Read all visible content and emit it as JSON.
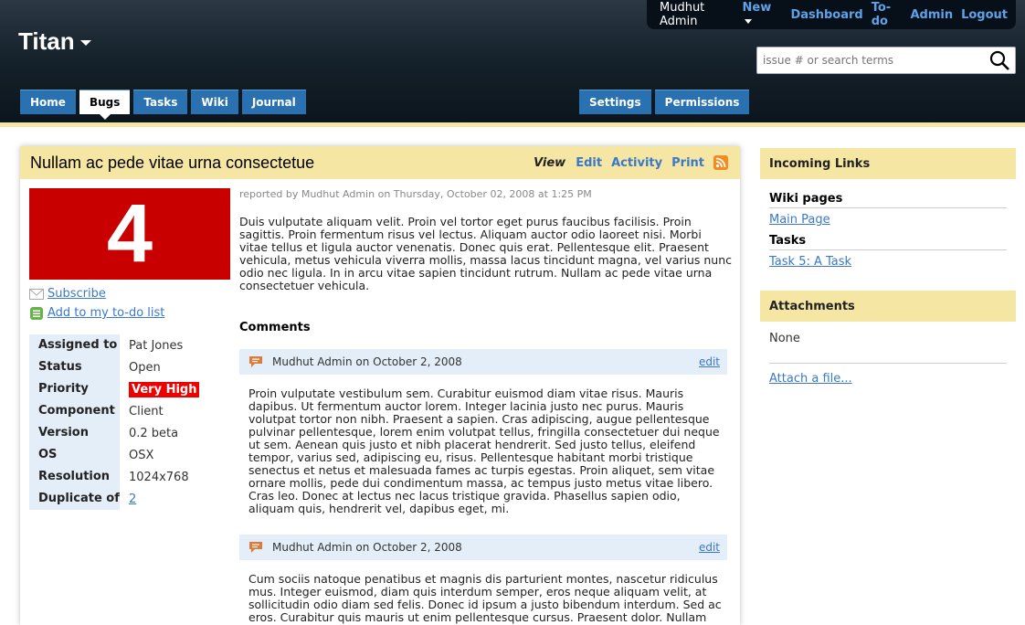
{
  "header": {
    "logo": "Titan",
    "user_name": "Mudhut Admin",
    "nav_links": [
      "New",
      "Dashboard",
      "To-do",
      "Admin",
      "Logout"
    ],
    "search_placeholder": "issue # or search terms",
    "tabs": [
      "Home",
      "Bugs",
      "Tasks",
      "Wiki",
      "Journal"
    ],
    "active_tab": "Bugs",
    "right_tabs": [
      "Settings",
      "Permissions"
    ]
  },
  "issue": {
    "title": "Nullam ac pede vitae urna consectetue",
    "view_label": "View",
    "view_links": [
      "Edit",
      "Activity",
      "Print"
    ],
    "number": "4",
    "subscribe": "Subscribe",
    "add_todo": "Add to my to-do list",
    "reported_by": "reported by Mudhut Admin on Thursday, October 02, 2008 at 1:25 PM",
    "description": "Duis vulputate aliquam velit. Proin vel tortor eget purus faucibus facilisis. Proin sagittis. Proin fermentum risus vel lectus. Aliquam auctor odio laoreet nisi. Morbi vitae tellus et ligula auctor venenatis. Donec quis erat. Pellentesque elit. Praesent vehicula, metus vehicula viverra mollis, massa lacus tincidunt magna, vel varius nunc odio nec ligula. In in arcu vitae sapien tincidunt rutrum. Nullam ac pede vitae urna consectetuer vehicula.",
    "properties": [
      {
        "key": "Assigned to",
        "value": "Pat Jones"
      },
      {
        "key": "Status",
        "value": "Open"
      },
      {
        "key": "Priority",
        "value": "Very High"
      },
      {
        "key": "Component",
        "value": "Client"
      },
      {
        "key": "Version",
        "value": "0.2 beta"
      },
      {
        "key": "OS",
        "value": "OSX"
      },
      {
        "key": "Resolution",
        "value": "1024x768"
      },
      {
        "key": "Duplicate of",
        "value": "2"
      }
    ]
  },
  "comments": {
    "heading": "Comments",
    "items": [
      {
        "author": "Mudhut Admin on October 2, 2008",
        "edit": "edit",
        "text": "Proin vulputate vestibulum sem. Curabitur euismod diam vitae risus. Mauris dapibus. Ut fermentum auctor lorem. Integer lacinia justo nec purus. Mauris volutpat tortor non nibh. Praesent a sapien. Cras adipiscing, augue pellentesque pulvinar pellentesque, lorem enim volutpat tellus, fringilla consectetuer dui neque ut sem. Aenean quis justo et nibh placerat hendrerit. Sed justo tellus, eleifend tempor, varius sed, adipiscing eu, risus. Pellentesque habitant morbi tristique senectus et netus et malesuada fames ac turpis egestas. Proin aliquet, sem vitae ornare mollis, pede dui condimentum massa, ac tempus justo metus vitae libero. Cras leo. Donec at lectus nec lacus tristique gravida. Phasellus sapien odio, aliquam quis, hendrerit vel, dapibus eget, mi."
      },
      {
        "author": "Mudhut Admin on October 2, 2008",
        "edit": "edit",
        "text": "Cum sociis natoque penatibus et magnis dis parturient montes, nascetur ridiculus mus. Integer euismod, diam quis interdum semper, eros neque aliquam velit, at sollicitudin odio diam sed felis. Donec id ipsum a justo bibendum interdum. Sed ac eros. Curabitur quis mauris ut enim pellentesque cursus. Praesent dolor. Nullam"
      }
    ]
  },
  "sidebar": {
    "incoming_heading": "Incoming Links",
    "wiki_heading": "Wiki pages",
    "wiki_link": "Main Page",
    "tasks_heading": "Tasks",
    "task_link": "Task 5: A Task",
    "attachments_heading": "Attachments",
    "attachments_none": "None",
    "attach_link": "Attach a file..."
  },
  "colors": {
    "accent_blue": "#2a71b2",
    "title_yellow": "#f5e6a3",
    "priority_red": "#ee0000",
    "number_red": "#c90000"
  }
}
